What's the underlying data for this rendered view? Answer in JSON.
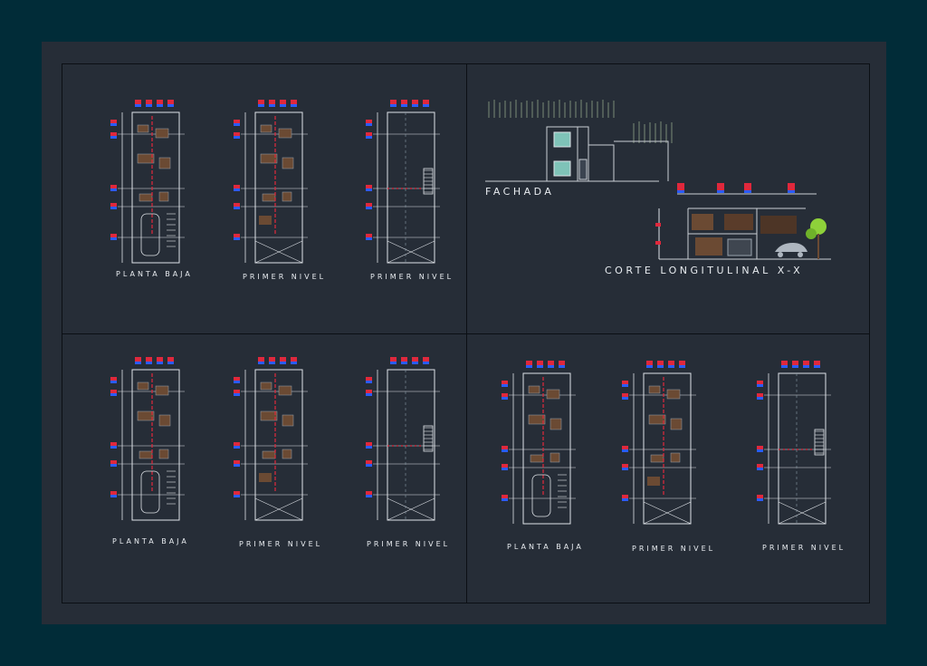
{
  "labels": {
    "q1_a": "PLANTA BAJA",
    "q1_b": "PRIMER NIVEL",
    "q1_c": "PRIMER NIVEL",
    "facade": "FACHADA",
    "section": "CORTE LONGITULINAL X-X",
    "q3_a": "PLANTA BAJA",
    "q3_b": "PRIMER NIVEL",
    "q3_c": "PRIMER NIVEL",
    "q4_a": "PLANTA BAJA",
    "q4_b": "PRIMER NIVEL",
    "q4_c": "PRIMER NIVEL"
  },
  "colors": {
    "outer_bg": "#012c38",
    "sheet_bg": "#262d37",
    "line_white": "#dfe3e8",
    "line_red": "#e0283c",
    "line_blue": "#2a5cff",
    "line_magenta": "#ff40c8",
    "furniture": "#6b4a33",
    "tree": "#8ed13a",
    "window_teal": "#7fc3b8"
  },
  "icons": [
    "elevation-marker-icon",
    "tree-icon",
    "car-icon"
  ]
}
